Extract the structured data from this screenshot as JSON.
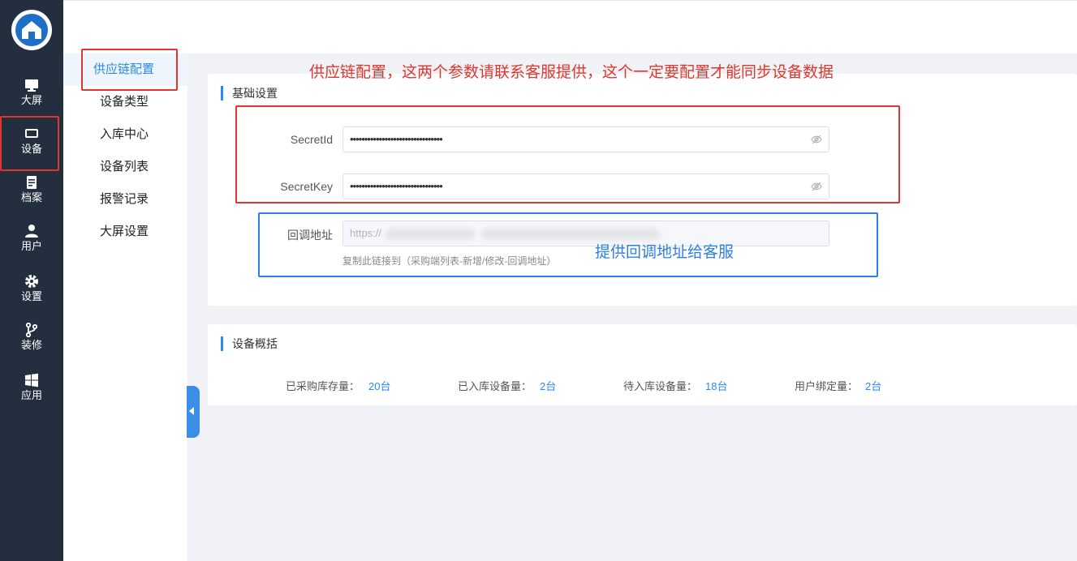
{
  "rail": {
    "items": [
      {
        "label": "大屏",
        "icon": "monitor-icon"
      },
      {
        "label": "设备",
        "icon": "device-icon"
      },
      {
        "label": "档案",
        "icon": "archive-icon"
      },
      {
        "label": "用户",
        "icon": "user-icon"
      },
      {
        "label": "设置",
        "icon": "gear-icon"
      },
      {
        "label": "装修",
        "icon": "branch-icon"
      },
      {
        "label": "应用",
        "icon": "windows-icon"
      }
    ]
  },
  "submenu": {
    "items": [
      {
        "label": "供应链配置"
      },
      {
        "label": "设备类型"
      },
      {
        "label": "入库中心"
      },
      {
        "label": "设备列表"
      },
      {
        "label": "报警记录"
      },
      {
        "label": "大屏设置"
      }
    ]
  },
  "basic": {
    "title": "基础设置",
    "secret_id_label": "SecretId",
    "secret_id_value": "••••••••••••••••••••••••••••••••",
    "secret_key_label": "SecretKey",
    "secret_key_value": "••••••••••••••••••••••••••••••••",
    "callback_label": "回调地址",
    "callback_value": "https://",
    "callback_hint": "复制此链接到（采购端列表-新增/修改-回调地址）"
  },
  "overview": {
    "title": "设备概括",
    "stats": [
      {
        "label": "已采购库存量：",
        "value": "20台"
      },
      {
        "label": "已入库设备量：",
        "value": "2台"
      },
      {
        "label": "待入库设备量：",
        "value": "18台"
      },
      {
        "label": "用户绑定量：",
        "value": "2台"
      }
    ]
  },
  "annotations": {
    "top_note": "供应链配置，这两个参数请联系客服提供，这个一定要配置才能同步设备数据",
    "callback_note": "提供回调地址给客服"
  },
  "colors": {
    "accent": "#2d8ae6",
    "rail_bg": "#232f3e",
    "annotation_red": "#e0362f",
    "annotation_blue": "#2d7fe6"
  }
}
